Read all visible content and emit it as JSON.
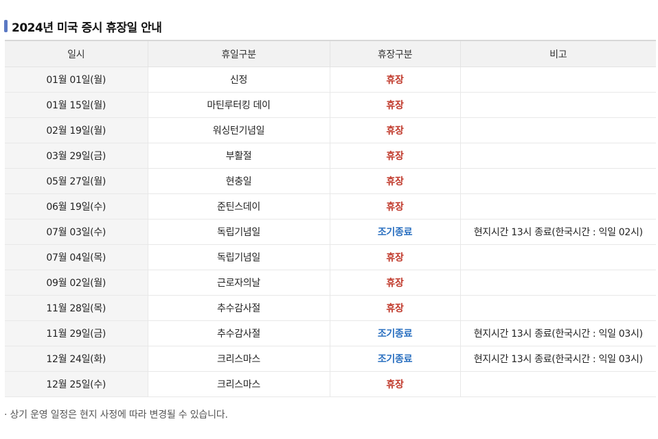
{
  "title": "2024년 미국 증시 휴장일 안내",
  "colors": {
    "closed": "#c0392b",
    "early": "#2a6fc0",
    "accent": "#5b79c4"
  },
  "table": {
    "headers": [
      "일시",
      "휴일구분",
      "휴장구분",
      "비고"
    ],
    "rows": [
      {
        "date": "01월 01일(월)",
        "holiday": "신정",
        "status": "휴장",
        "status_type": "closed",
        "note": ""
      },
      {
        "date": "01월 15일(월)",
        "holiday": "마틴루터킹 데이",
        "status": "휴장",
        "status_type": "closed",
        "note": ""
      },
      {
        "date": "02월 19일(월)",
        "holiday": "워싱턴기념일",
        "status": "휴장",
        "status_type": "closed",
        "note": ""
      },
      {
        "date": "03월 29일(금)",
        "holiday": "부활절",
        "status": "휴장",
        "status_type": "closed",
        "note": ""
      },
      {
        "date": "05월 27일(월)",
        "holiday": "현충일",
        "status": "휴장",
        "status_type": "closed",
        "note": ""
      },
      {
        "date": "06월 19일(수)",
        "holiday": "준틴스데이",
        "status": "휴장",
        "status_type": "closed",
        "note": ""
      },
      {
        "date": "07월 03일(수)",
        "holiday": "독립기념일",
        "status": "조기종료",
        "status_type": "early",
        "note": "현지시간 13시 종료(한국시간 : 익일 02시)"
      },
      {
        "date": "07월 04일(목)",
        "holiday": "독립기념일",
        "status": "휴장",
        "status_type": "closed",
        "note": ""
      },
      {
        "date": "09월 02일(월)",
        "holiday": "근로자의날",
        "status": "휴장",
        "status_type": "closed",
        "note": ""
      },
      {
        "date": "11월 28일(목)",
        "holiday": "추수감사절",
        "status": "휴장",
        "status_type": "closed",
        "note": ""
      },
      {
        "date": "11월 29일(금)",
        "holiday": "추수감사절",
        "status": "조기종료",
        "status_type": "early",
        "note": "현지시간 13시 종료(한국시간 : 익일 03시)"
      },
      {
        "date": "12월 24일(화)",
        "holiday": "크리스마스",
        "status": "조기종료",
        "status_type": "early",
        "note": "현지시간 13시 종료(한국시간 : 익일 03시)"
      },
      {
        "date": "12월 25일(수)",
        "holiday": "크리스마스",
        "status": "휴장",
        "status_type": "closed",
        "note": ""
      }
    ]
  },
  "footnote": "· 상기 운영 일정은 현지 사정에 따라 변경될 수 있습니다."
}
